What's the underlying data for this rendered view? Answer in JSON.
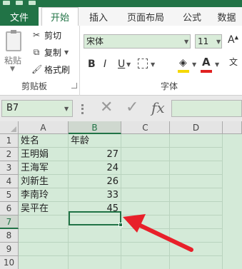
{
  "ribbon": {
    "tabs": [
      "文件",
      "开始",
      "插入",
      "页面布局",
      "公式",
      "数据"
    ],
    "clipboard": {
      "paste": "粘贴",
      "cut": "剪切",
      "copy": "复制",
      "format_painter": "格式刷",
      "group_label": "剪贴板"
    },
    "font": {
      "name": "宋体",
      "size": "11",
      "group_label": "字体"
    }
  },
  "formula_bar": {
    "name_box": "B7",
    "formula": ""
  },
  "sheet": {
    "columns": [
      "A",
      "B",
      "C",
      "D"
    ],
    "rows": [
      "1",
      "2",
      "3",
      "4",
      "5",
      "6",
      "7",
      "8",
      "9",
      "10"
    ],
    "cells": [
      [
        "姓名",
        "年龄"
      ],
      [
        "王明娟",
        "27"
      ],
      [
        "王海军",
        "24"
      ],
      [
        "刘新生",
        "26"
      ],
      [
        "李南玲",
        "33"
      ],
      [
        "吴平在",
        "45"
      ]
    ],
    "selected_cell": "B7"
  },
  "colors": {
    "accent": "#217346",
    "sheet_background": "#d4ead8",
    "arrow": "#e8202a"
  }
}
